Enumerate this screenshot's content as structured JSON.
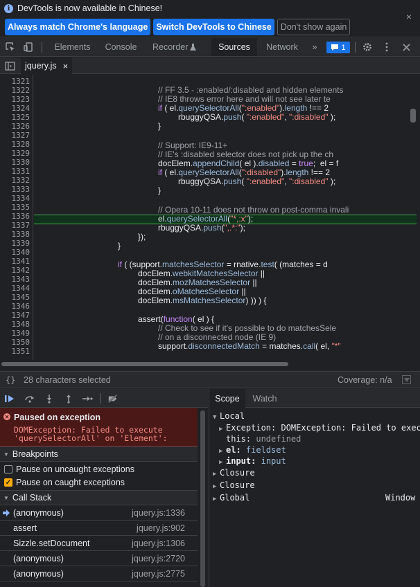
{
  "infobar": {
    "message": "DevTools is now available in Chinese!",
    "btn_match": "Always match Chrome's language",
    "btn_switch": "Switch DevTools to Chinese",
    "btn_dismiss": "Don't show again",
    "close": "×"
  },
  "tabs": [
    "Elements",
    "Console",
    "Recorder",
    "Sources",
    "Network"
  ],
  "active_tab": "Sources",
  "more_tabs": "»",
  "issues_count": "1",
  "file_tab": {
    "name": "jquery.js",
    "close": "×"
  },
  "editor": {
    "line_numbers": [
      "1321",
      "1322",
      "1323",
      "1324",
      "1325",
      "1326",
      "1327",
      "1328",
      "1329",
      "1330",
      "1331",
      "1332",
      "1333",
      "1334",
      "1335",
      "1336",
      "1337",
      "1338",
      "1339",
      "1340",
      "1341",
      "1342",
      "1343",
      "1344",
      "1345",
      "1346",
      "1347",
      "1348",
      "1349",
      "1350",
      "1351"
    ],
    "code": {
      "l1322": "// FF 3.5 - :enabled/:disabled and hidden elements",
      "l1323": "// IE8 throws error here and will not see later te",
      "l1324_a": "if",
      "l1324_b": " ( el.",
      "l1324_c": "querySelectorAll",
      "l1324_d": "(",
      "l1324_e": "\":enabled\"",
      "l1324_f": ").",
      "l1324_g": "length",
      "l1324_h": " !== 2",
      "l1325_a": "rbuggyQSA.",
      "l1325_b": "push",
      "l1325_c": "( ",
      "l1325_d": "\":enabled\"",
      "l1325_e": ", ",
      "l1325_f": "\":disabled\"",
      "l1325_g": " );",
      "l1326": "}",
      "l1328": "// Support: IE9-11+",
      "l1329": "// IE's :disabled selector does not pick up the ch",
      "l1330_a": "docElem.",
      "l1330_b": "appendChild",
      "l1330_c": "( el ).",
      "l1330_d": "disabled",
      "l1330_e": " = ",
      "l1330_f": "true",
      "l1330_g": ";  el = f",
      "l1331_a": "if",
      "l1331_b": " ( el.",
      "l1331_c": "querySelectorAll",
      "l1331_d": "(",
      "l1331_e": "\":disabled\"",
      "l1331_f": ").",
      "l1331_g": "length",
      "l1331_h": " !== 2",
      "l1332_a": "rbuggyQSA.",
      "l1332_b": "push",
      "l1332_c": "( ",
      "l1332_d": "\":enabled\"",
      "l1332_e": ", ",
      "l1332_f": "\":disabled\"",
      "l1332_g": " );",
      "l1333": "}",
      "l1335": "// Opera 10-11 does not throw on post-comma invali",
      "l1336_a": "el.",
      "l1336_b": "querySelectorAll",
      "l1336_c": "(",
      "l1336_d": "\"*,:x\"",
      "l1336_e": ");",
      "l1337_a": "rbuggyQSA.",
      "l1337_b": "push",
      "l1337_c": "(",
      "l1337_d": "\",.*:\"",
      "l1337_e": ");",
      "l1338": "});",
      "l1339": "}",
      "l1341_a": "if",
      "l1341_b": " ( (support.",
      "l1341_c": "matchesSelector",
      "l1341_d": " = rnative.",
      "l1341_e": "test",
      "l1341_f": "( (matches = d",
      "l1342_a": "docElem.",
      "l1342_b": "webkitMatchesSelector",
      "l1342_c": " ||",
      "l1343_a": "docElem.",
      "l1343_b": "mozMatchesSelector",
      "l1343_c": " ||",
      "l1344_a": "docElem.",
      "l1344_b": "oMatchesSelector",
      "l1344_c": " ||",
      "l1345_a": "docElem.",
      "l1345_b": "msMatchesSelector",
      "l1345_c": ") )) ) {",
      "l1347_a": "assert",
      "l1347_b": "(",
      "l1347_c": "function",
      "l1347_d": "( el ) {",
      "l1348": "// Check to see if it's possible to do matchesSele",
      "l1349": "// on a disconnected node (IE 9)",
      "l1350_a": "support.",
      "l1350_b": "disconnectedMatch",
      "l1350_c": " = matches.",
      "l1350_d": "call",
      "l1350_e": "( el, ",
      "l1350_f": "\"*\""
    }
  },
  "status": {
    "braces": "{}",
    "selection": "28 characters selected",
    "coverage": "Coverage: n/a"
  },
  "paused": {
    "title": "Paused on exception",
    "message_line1": "DOMException: Failed to execute",
    "message_line2": "'querySelectorAll' on 'Element':"
  },
  "breakpoints": {
    "title": "Breakpoints",
    "uncaught": "Pause on uncaught exceptions",
    "uncaught_checked": false,
    "caught": "Pause on caught exceptions",
    "caught_checked": true
  },
  "callstack": {
    "title": "Call Stack",
    "frames": [
      {
        "fn": "(anonymous)",
        "loc": "jquery.js:1336",
        "current": true
      },
      {
        "fn": "assert",
        "loc": "jquery.js:902"
      },
      {
        "fn": "Sizzle.setDocument",
        "loc": "jquery.js:1306"
      },
      {
        "fn": "(anonymous)",
        "loc": "jquery.js:2720"
      },
      {
        "fn": "(anonymous)",
        "loc": "jquery.js:2775"
      }
    ]
  },
  "scope_tabs": [
    "Scope",
    "Watch"
  ],
  "scope": {
    "local": "Local",
    "exception_key": "Exception:",
    "exception_val": "DOMException: Failed to exec",
    "this_key": "this:",
    "this_val": "undefined",
    "el_key": "el:",
    "el_val": "fieldset",
    "input_key": "input:",
    "input_val": "input",
    "closure1": "Closure",
    "closure2": "Closure",
    "global": "Global",
    "global_val": "Window"
  },
  "colors": {
    "accent": "#1a73e8",
    "exception_bg": "#4b1818",
    "exception_text": "#f28b82",
    "highlight_line": "#10311b",
    "checkbox_on": "#f9ab00"
  }
}
